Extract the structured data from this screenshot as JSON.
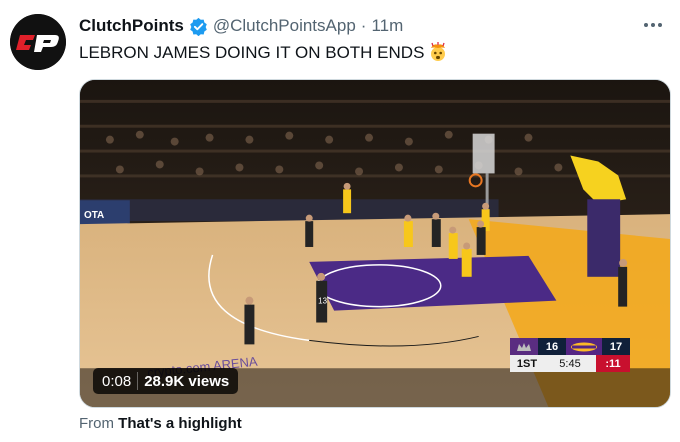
{
  "tweet": {
    "author_name": "ClutchPoints",
    "author_handle": "@ClutchPointsApp",
    "separator": "·",
    "time": "11m",
    "text": "LEBRON JAMES DOING IT ON BOTH ENDS",
    "emoji": "🤯",
    "avatar_logo_text": "CP",
    "verified_icon": "verified-badge-icon",
    "more_icon": "more-dots-icon"
  },
  "media": {
    "duration": "0:08",
    "views": "28.9K views",
    "court_text_left": "crypto.com ARENA",
    "ad_text": "OTA",
    "player_jersey": "13",
    "scoreboard": {
      "home_score": "16",
      "away_score": "17",
      "period": "1ST",
      "clock": "5:45",
      "shot_clock": ":11"
    }
  },
  "attribution": {
    "prefix": "From",
    "source": "That's a highlight"
  },
  "colors": {
    "accent_blue": "#1d9bf0",
    "brand_red": "#e0202a",
    "lakers_purple": "#552583",
    "lakers_gold": "#fdb927",
    "secondary_text": "#536471"
  }
}
